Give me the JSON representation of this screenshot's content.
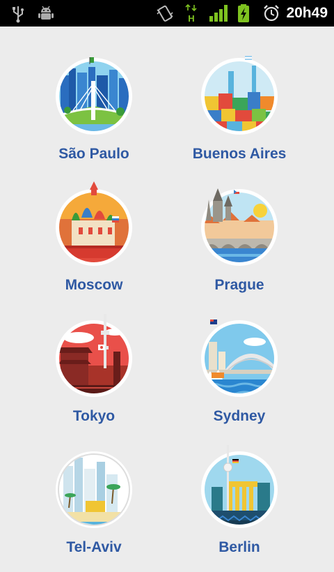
{
  "status_bar": {
    "time": "20h49",
    "icons": [
      "usb-icon",
      "android-debug-icon",
      "vibrate-icon",
      "network-h-icon",
      "signal-icon",
      "battery-charging-icon",
      "alarm-icon"
    ],
    "network_label": "H",
    "accent": "#7ec220"
  },
  "cities": [
    {
      "name": "São Paulo",
      "sky": "#8fd3ef"
    },
    {
      "name": "Buenos Aires",
      "sky": "#cfeaf5"
    },
    {
      "name": "Moscow",
      "sky": "#f5a93a"
    },
    {
      "name": "Prague",
      "sky": "#bfe4f3"
    },
    {
      "name": "Tokyo",
      "sky": "#e9504a"
    },
    {
      "name": "Sydney",
      "sky": "#7fc9ec"
    },
    {
      "name": "Tel-Aviv",
      "sky": "#ffffff"
    },
    {
      "name": "Berlin",
      "sky": "#9fd8ee"
    }
  ],
  "colors": {
    "caption": "#2f59a3",
    "background": "#ececec",
    "status_bar": "#000000"
  }
}
